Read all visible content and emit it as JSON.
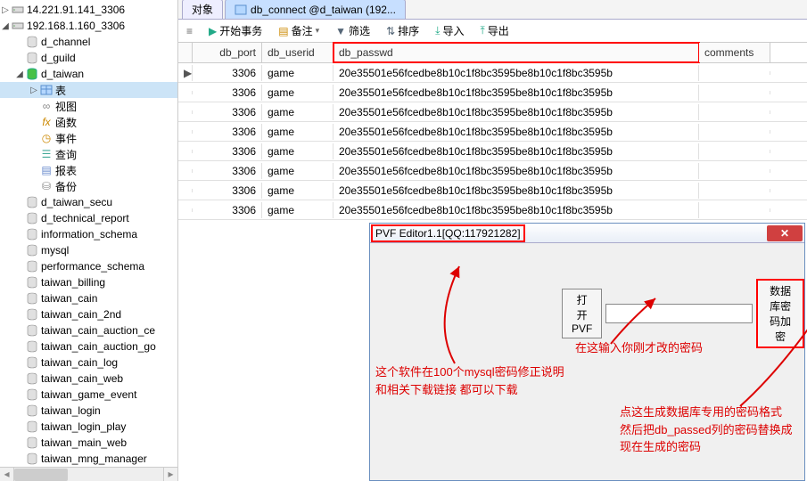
{
  "sidebar": {
    "servers": [
      {
        "label": "14.221.91.141_3306",
        "open": false
      },
      {
        "label": "192.168.1.160_3306",
        "open": true
      }
    ],
    "databases": [
      "d_channel",
      "d_guild",
      "d_taiwan"
    ],
    "current_db_children": [
      {
        "label": "表",
        "kind": "table",
        "selected": true
      },
      {
        "label": "视图",
        "kind": "view"
      },
      {
        "label": "函数",
        "kind": "func"
      },
      {
        "label": "事件",
        "kind": "event"
      },
      {
        "label": "查询",
        "kind": "query"
      },
      {
        "label": "报表",
        "kind": "report"
      },
      {
        "label": "备份",
        "kind": "backup"
      }
    ],
    "rest_dbs": [
      "d_taiwan_secu",
      "d_technical_report",
      "information_schema",
      "mysql",
      "performance_schema",
      "taiwan_billing",
      "taiwan_cain",
      "taiwan_cain_2nd",
      "taiwan_cain_auction_ce",
      "taiwan_cain_auction_go",
      "taiwan_cain_log",
      "taiwan_cain_web",
      "taiwan_game_event",
      "taiwan_login",
      "taiwan_login_play",
      "taiwan_main_web",
      "taiwan_mng_manager"
    ]
  },
  "tabs": {
    "t1": "对象",
    "t2": "db_connect @d_taiwan (192..."
  },
  "toolbar": {
    "begin_tx": "开始事务",
    "memo": "备注",
    "filter": "筛选",
    "sort": "排序",
    "import": "导入",
    "export": "导出"
  },
  "grid": {
    "columns": {
      "db_port": "db_port",
      "db_userid": "db_userid",
      "db_passwd": "db_passwd",
      "comments": "comments"
    },
    "rows": [
      {
        "port": 3306,
        "user": "game",
        "pass": "20e35501e56fcedbe8b10c1f8bc3595be8b10c1f8bc3595b"
      },
      {
        "port": 3306,
        "user": "game",
        "pass": "20e35501e56fcedbe8b10c1f8bc3595be8b10c1f8bc3595b"
      },
      {
        "port": 3306,
        "user": "game",
        "pass": "20e35501e56fcedbe8b10c1f8bc3595be8b10c1f8bc3595b"
      },
      {
        "port": 3306,
        "user": "game",
        "pass": "20e35501e56fcedbe8b10c1f8bc3595be8b10c1f8bc3595b"
      },
      {
        "port": 3306,
        "user": "game",
        "pass": "20e35501e56fcedbe8b10c1f8bc3595be8b10c1f8bc3595b"
      },
      {
        "port": 3306,
        "user": "game",
        "pass": "20e35501e56fcedbe8b10c1f8bc3595be8b10c1f8bc3595b"
      },
      {
        "port": 3306,
        "user": "game",
        "pass": "20e35501e56fcedbe8b10c1f8bc3595be8b10c1f8bc3595b"
      },
      {
        "port": 3306,
        "user": "game",
        "pass": "20e35501e56fcedbe8b10c1f8bc3595be8b10c1f8bc3595b"
      }
    ]
  },
  "dialog": {
    "title": "PVF Editor1.1[QQ:117921282]",
    "open_btn": "打开PVF",
    "input_value": "",
    "encrypt_btn": "数据库密码加密"
  },
  "annotations": {
    "left": "这个软件在100个mysql密码修正说明\n和相关下载链接 都可以下载",
    "mid": "在这输入你刚才改的密码",
    "right": "点这生成数据库专用的密码格式\n然后把db_passed列的密码替换成\n现在生成的密码"
  }
}
